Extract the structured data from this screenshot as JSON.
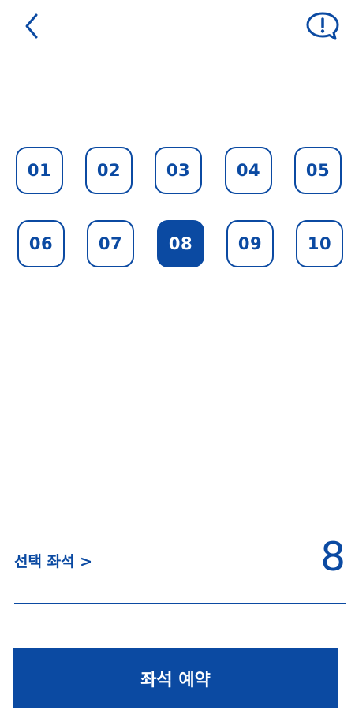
{
  "header": {
    "back_icon": "chevron-left-icon",
    "help_icon": "speech-bubble-exclamation-icon"
  },
  "seats": [
    {
      "label": "01",
      "selected": false
    },
    {
      "label": "02",
      "selected": false
    },
    {
      "label": "03",
      "selected": false
    },
    {
      "label": "04",
      "selected": false
    },
    {
      "label": "05",
      "selected": false
    },
    {
      "label": "06",
      "selected": false
    },
    {
      "label": "07",
      "selected": false
    },
    {
      "label": "08",
      "selected": true
    },
    {
      "label": "09",
      "selected": false
    },
    {
      "label": "10",
      "selected": false
    }
  ],
  "selection": {
    "label": "선택 좌석 >",
    "value": "8"
  },
  "reserve_button": {
    "label": "좌석 예약"
  },
  "colors": {
    "primary": "#0b4aa2",
    "background": "#ffffff"
  }
}
